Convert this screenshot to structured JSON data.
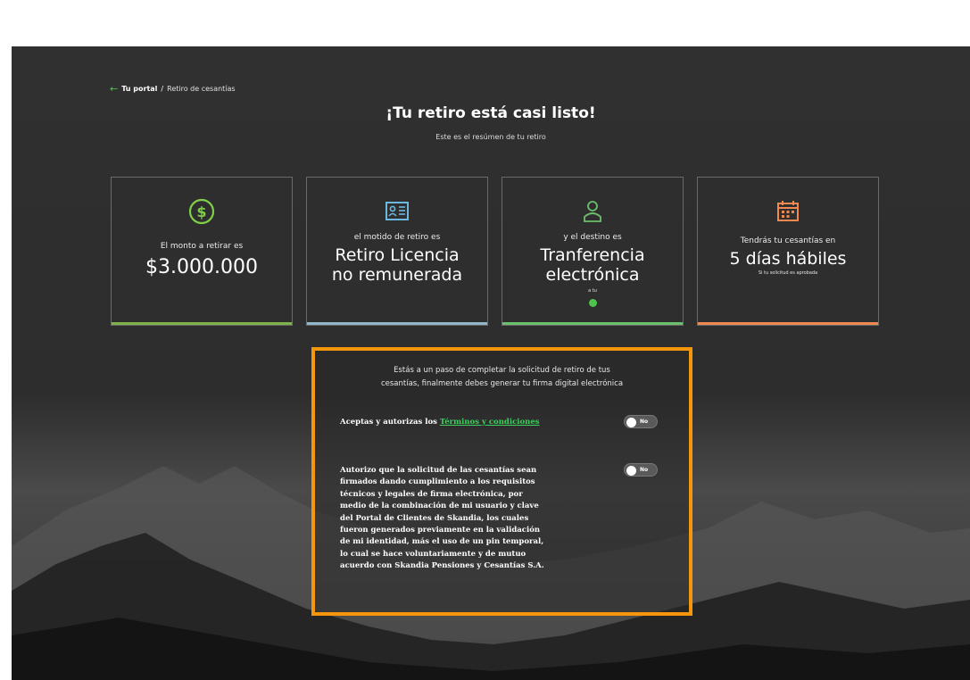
{
  "breadcrumb": {
    "portal": "Tu portal",
    "separator": "/",
    "current": "Retiro de cesantías"
  },
  "header": {
    "title": "¡Tu retiro está casi listo!",
    "subtitle": "Este es el resúmen de tu retiro"
  },
  "cards": [
    {
      "icon": "dollar-coin-icon",
      "label": "El monto a retirar es",
      "value": "$3.000.000",
      "accent": "#7fb34a"
    },
    {
      "icon": "id-card-icon",
      "label": "el motido de retiro es",
      "value_line1": "Retiro Licencia",
      "value_line2": "no remunerada",
      "accent": "#8fb9c9"
    },
    {
      "icon": "user-icon",
      "label": "y el destino es",
      "value_line1": "Tranferencia",
      "value_line2": "electrónica",
      "small": "a tu",
      "accent": "#6cbf6c"
    },
    {
      "icon": "calendar-icon",
      "label": "Tendrás tu cesantías en",
      "value": "5 días hábiles",
      "note": "Si tu solicitud es aprobada",
      "accent": "#f0894f"
    }
  ],
  "confirmation": {
    "intro_line1": "Estás a un paso de completar la solicitud de retiro de tus",
    "intro_line2": "cesantías, finalmente debes generar tu firma digital electrónica",
    "terms_prefix": "Aceptas y autorizas los",
    "terms_link": "Términos y condiciones",
    "terms_toggle_label": "No",
    "consent_lines": [
      "Autorizo que la solicitud de las cesantías sean",
      "firmados dando cumplimiento a los requisitos",
      "técnicos y legales de firma electrónica, por",
      "medio de la combinación de mi usuario y clave",
      "del Portal de Clientes de Skandia, los cuales",
      "fueron generados previamente en la validación",
      "de mi identidad, más el uso de un pin temporal,",
      "lo cual se hace voluntariamente y de mutuo",
      "acuerdo con Skandia Pensiones y Cesantías S.A."
    ],
    "consent_toggle_label": "No"
  },
  "colors": {
    "focus_border": "#f5960b",
    "green": "#4ec24e",
    "orange_icon": "#f0894f"
  }
}
